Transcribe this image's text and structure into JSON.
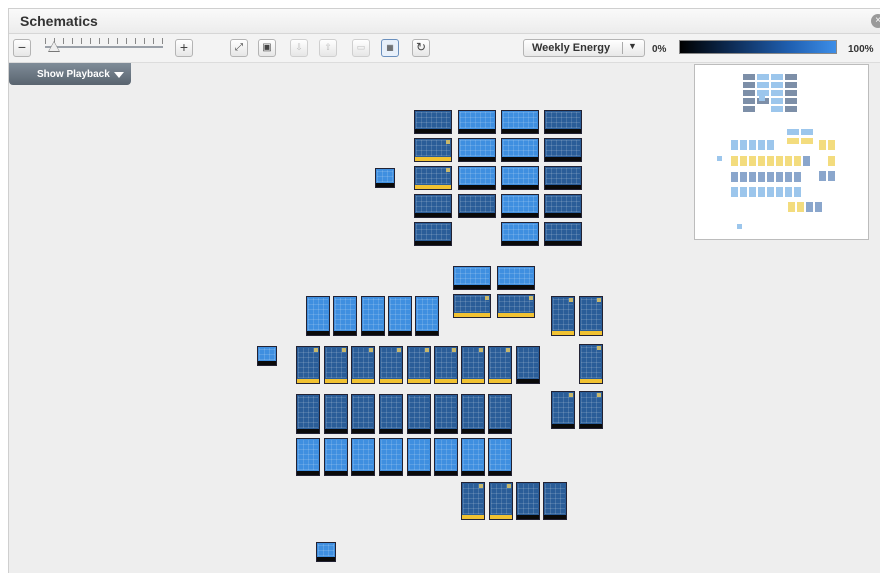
{
  "window": {
    "title": "Schematics"
  },
  "toolbar": {
    "zoom_out_label": "−",
    "zoom_in_label": "+",
    "metric_dropdown": {
      "selected": "Weekly Energy"
    },
    "legend": {
      "min_label": "0%",
      "max_label": "100%"
    }
  },
  "playback": {
    "label": "Show Playback"
  },
  "colors": {
    "low": "#000000",
    "high": "#3d8ee8",
    "warning": "#f1c232"
  }
}
